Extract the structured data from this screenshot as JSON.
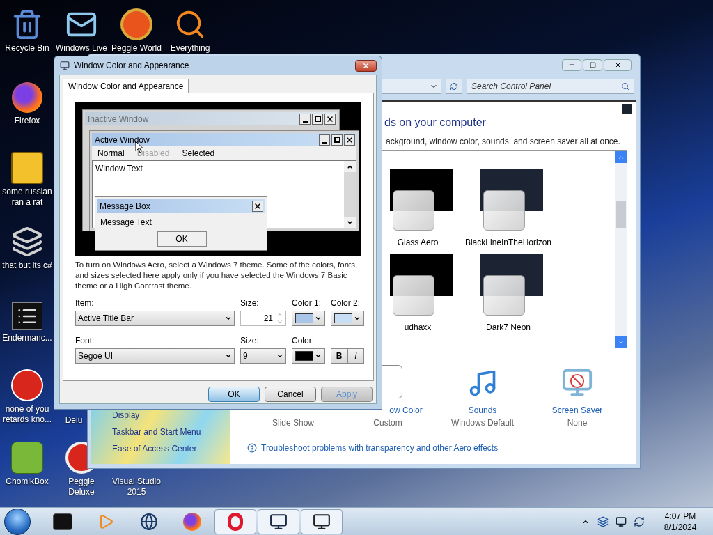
{
  "desktop_icons": [
    {
      "label": "Recycle Bin"
    },
    {
      "label": "Windows Live"
    },
    {
      "label": "Peggle World"
    },
    {
      "label": "Everything"
    },
    {
      "label": "Firefox"
    },
    {
      "label": "some russian ran a rat"
    },
    {
      "label": "that but its c#"
    },
    {
      "label": "Endermanc..."
    },
    {
      "label": "none of you retards kno..."
    },
    {
      "label": "Delu"
    },
    {
      "label": "ChomikBox"
    },
    {
      "label": "Peggle Deluxe"
    },
    {
      "label": "Visual Studio 2015"
    }
  ],
  "control_panel": {
    "search_placeholder": "Search Control Panel",
    "heading": "ds on your computer",
    "subtitle": "ackground, window color, sounds, and screen saver all at once.",
    "themes": [
      {
        "label": "Glass Aero"
      },
      {
        "label": "BlackLineInTheHorizon"
      },
      {
        "label": "udhaxx"
      },
      {
        "label": "Dark7 Neon"
      }
    ],
    "settings": [
      {
        "value": "Slide Show"
      },
      {
        "label": "ow Color",
        "value": "Custom"
      },
      {
        "label": "Sounds",
        "value": "Windows Default"
      },
      {
        "label": "Screen Saver",
        "value": "None"
      }
    ],
    "link": "Troubleshoot problems with transparency and other Aero effects",
    "side_links": [
      "Display",
      "Taskbar and Start Menu",
      "Ease of Access Center"
    ]
  },
  "dialog": {
    "title": "Window Color and Appearance",
    "tabs": [
      {
        "label": "Window Color and Appearance",
        "selected": true
      }
    ],
    "preview": {
      "inactive_title": "Inactive Window",
      "active_title": "Active Window",
      "menu": [
        {
          "label": "Normal",
          "kind": "normal"
        },
        {
          "label": "Disabled",
          "kind": "disabled"
        },
        {
          "label": "Selected",
          "kind": "normal"
        }
      ],
      "window_text": "Window Text",
      "message_title": "Message Box",
      "message_text": "Message Text",
      "message_button": "OK"
    },
    "note": "To turn on Windows Aero, select a Windows 7 theme.  Some of the colors, fonts, and sizes selected here apply only if you have selected the Windows 7 Basic theme or a High Contrast theme.",
    "item": {
      "label": "Item:",
      "value": "Active Title Bar"
    },
    "item_size": {
      "label": "Size:",
      "value": "21"
    },
    "color_1": {
      "label": "Color 1:",
      "color": "#a9c5e8"
    },
    "color_2": {
      "label": "Color 2:",
      "color": "#c8def4"
    },
    "font": {
      "label": "Font:",
      "value": "Segoe UI"
    },
    "font_size": {
      "label": "Size:",
      "value": "9"
    },
    "font_color": {
      "label": "Color:",
      "color": "#000000"
    },
    "bold": {
      "label": "B",
      "on": false
    },
    "italic": {
      "label": "I",
      "on": false
    },
    "buttons": [
      {
        "label": "OK",
        "kind": "default"
      },
      {
        "label": "Cancel",
        "kind": "normal"
      },
      {
        "label": "Apply",
        "kind": "disabled"
      }
    ]
  },
  "taskbar": {
    "items": [
      {
        "open": false
      },
      {
        "open": false
      },
      {
        "open": false
      },
      {
        "open": false
      },
      {
        "open": true
      },
      {
        "open": true
      },
      {
        "open": true
      }
    ],
    "time": "4:07 PM",
    "date": "8/1/2024"
  }
}
